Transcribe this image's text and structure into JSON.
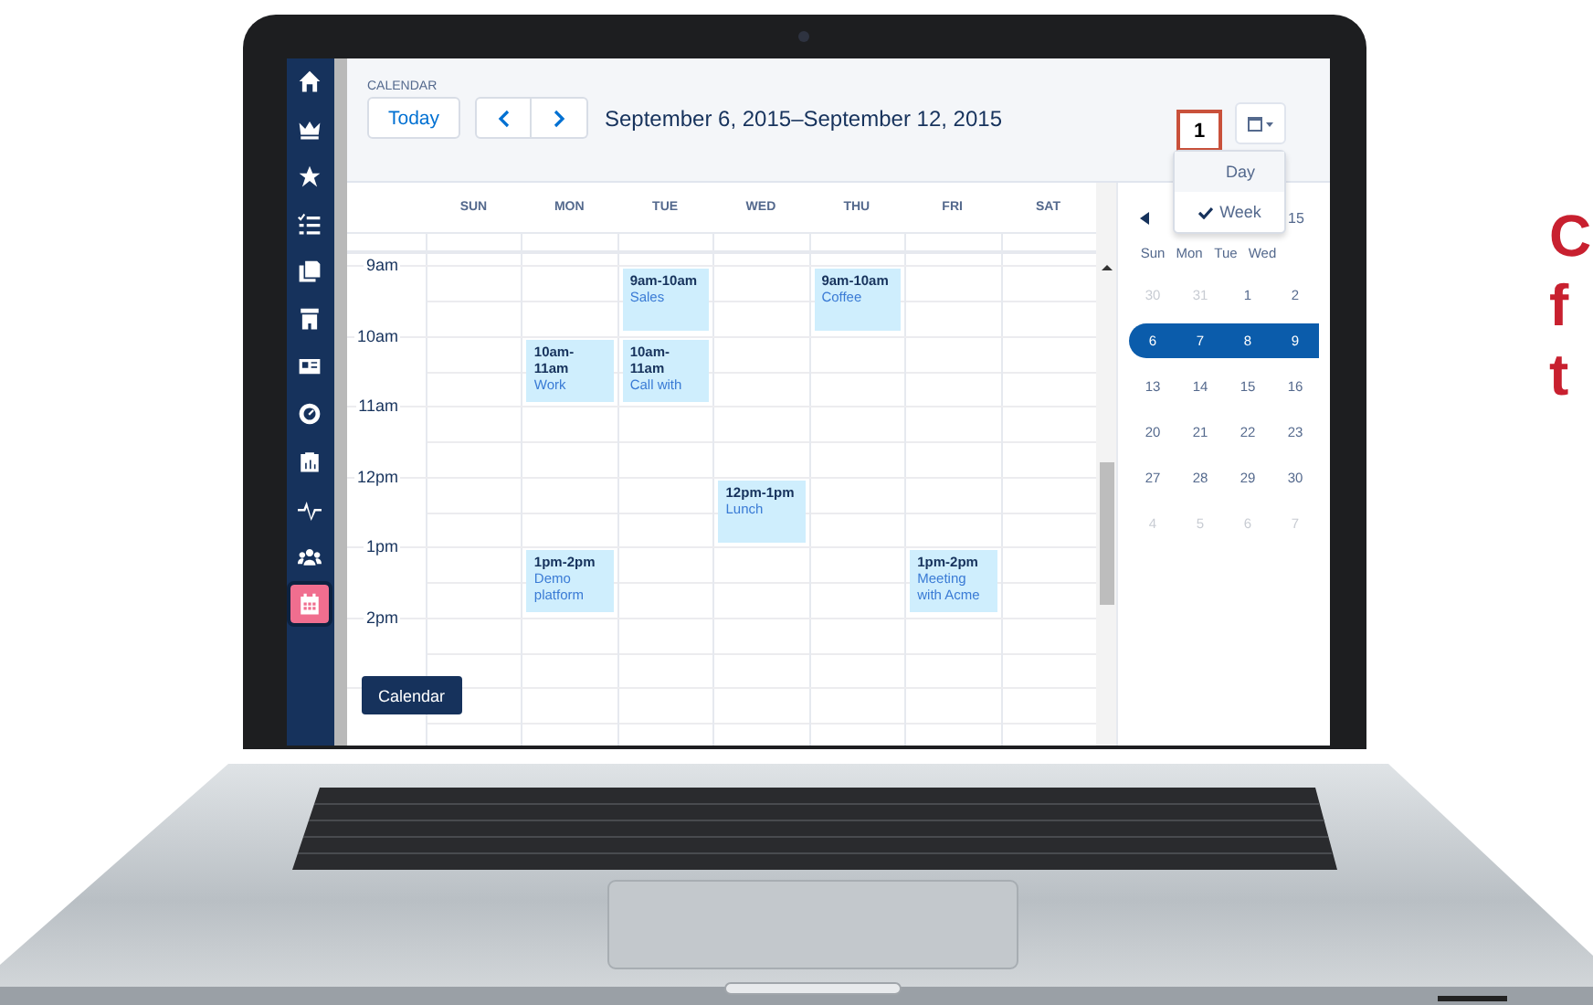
{
  "nav": [
    {
      "kind": "home",
      "selected": false
    },
    {
      "kind": "crown",
      "selected": false
    },
    {
      "kind": "star",
      "selected": false
    },
    {
      "kind": "checklist",
      "selected": false
    },
    {
      "kind": "documents",
      "selected": false
    },
    {
      "kind": "building",
      "selected": false
    },
    {
      "kind": "card",
      "selected": false
    },
    {
      "kind": "gauge",
      "selected": false
    },
    {
      "kind": "clipboard",
      "selected": false
    },
    {
      "kind": "pulse",
      "selected": false
    },
    {
      "kind": "people",
      "selected": false
    },
    {
      "kind": "calendar",
      "selected": true
    }
  ],
  "tooltip": "Calendar",
  "header": {
    "section": "CALENDAR",
    "today": "Today",
    "range": "September 6, 2015–September 12, 2015",
    "callout": "1"
  },
  "view_menu": [
    {
      "label": "Day",
      "hovered": true,
      "checked": false
    },
    {
      "label": "Week",
      "hovered": false,
      "checked": true
    }
  ],
  "days": [
    "SUN",
    "MON",
    "TUE",
    "WED",
    "THU",
    "FRI",
    "SAT"
  ],
  "hours": [
    {
      "label": "9am",
      "cells": [
        null,
        null,
        {
          "time": "9am-10am",
          "title": "Sales"
        },
        null,
        {
          "time": "9am-10am",
          "title": "Coffee"
        },
        null,
        null
      ]
    },
    {
      "label": "10am",
      "cells": [
        null,
        {
          "time": "10am-11am",
          "title": "Work"
        },
        {
          "time": "10am-11am",
          "title": "Call with"
        },
        null,
        null,
        null,
        null
      ]
    },
    {
      "label": "11am",
      "cells": [
        null,
        null,
        null,
        null,
        null,
        null,
        null
      ]
    },
    {
      "label": "12pm",
      "cells": [
        null,
        null,
        null,
        {
          "time": "12pm-1pm",
          "title": "Lunch"
        },
        null,
        null,
        null
      ]
    },
    {
      "label": "1pm",
      "cells": [
        null,
        {
          "time": "1pm-2pm",
          "title": "Demo platform"
        },
        null,
        null,
        null,
        {
          "time": "1pm-2pm",
          "title": "Meeting with Acme"
        },
        null
      ]
    },
    {
      "label": "2pm",
      "cells": [
        null,
        null,
        null,
        null,
        null,
        null,
        null
      ]
    }
  ],
  "mini_calendar": {
    "year_fragment": "15",
    "weekdays": [
      "Sun",
      "Mon",
      "Tue",
      "Wed"
    ],
    "weeks": [
      {
        "selected": false,
        "days": [
          {
            "label": "30",
            "muted": true
          },
          {
            "label": "31",
            "muted": true
          },
          {
            "label": "1",
            "muted": false
          },
          {
            "label": "2",
            "muted": false
          }
        ]
      },
      {
        "selected": true,
        "days": [
          {
            "label": "6",
            "muted": false
          },
          {
            "label": "7",
            "muted": false
          },
          {
            "label": "8",
            "muted": false
          },
          {
            "label": "9",
            "muted": false
          }
        ]
      },
      {
        "selected": false,
        "days": [
          {
            "label": "13",
            "muted": false
          },
          {
            "label": "14",
            "muted": false
          },
          {
            "label": "15",
            "muted": false
          },
          {
            "label": "16",
            "muted": false
          }
        ]
      },
      {
        "selected": false,
        "days": [
          {
            "label": "20",
            "muted": false
          },
          {
            "label": "21",
            "muted": false
          },
          {
            "label": "22",
            "muted": false
          },
          {
            "label": "23",
            "muted": false
          }
        ]
      },
      {
        "selected": false,
        "days": [
          {
            "label": "27",
            "muted": false
          },
          {
            "label": "28",
            "muted": false
          },
          {
            "label": "29",
            "muted": false
          },
          {
            "label": "30",
            "muted": false
          }
        ]
      },
      {
        "selected": false,
        "days": [
          {
            "label": "4",
            "muted": true
          },
          {
            "label": "5",
            "muted": true
          },
          {
            "label": "6",
            "muted": true
          },
          {
            "label": "7",
            "muted": true
          }
        ]
      }
    ]
  },
  "side_text": [
    "C",
    "f",
    "t"
  ]
}
